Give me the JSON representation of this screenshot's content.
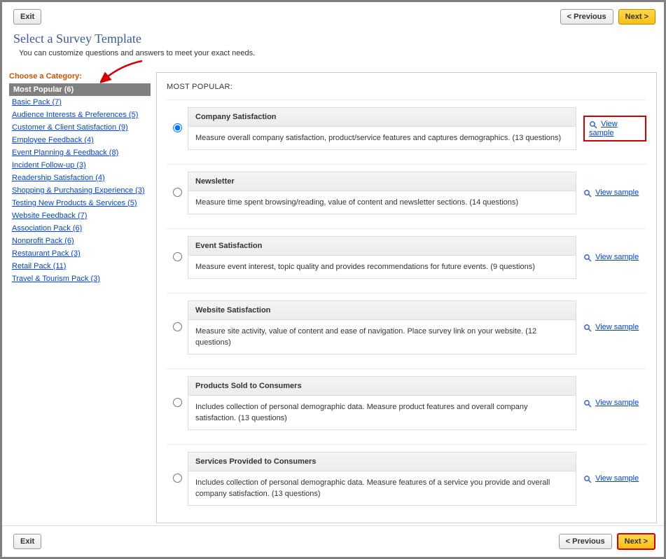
{
  "buttons": {
    "exit": "Exit",
    "previous": "< Previous",
    "next": "Next >"
  },
  "header": {
    "title": "Select a Survey Template",
    "subtitle": "You can customize questions and answers to meet your exact needs."
  },
  "sidebar": {
    "label": "Choose a Category:",
    "active": "Most Popular (6)",
    "items": [
      "Basic Pack (7)",
      "Audience Interests & Preferences (5)",
      "Customer & Client Satisfaction (9)",
      "Employee Feedback (4)",
      "Event Planning & Feedback (8)",
      "Incident Follow-up (3)",
      "Readership Satisfaction (4)",
      "Shopping & Purchasing Experience (3)",
      "Testing New Products & Services (5)",
      "Website Feedback (7)",
      "Association Pack (6)",
      "Nonprofit Pack (6)",
      "Restaurant Pack (3)",
      "Retail Pack (11)",
      "Travel & Tourism Pack (3)"
    ]
  },
  "content": {
    "section_title": "MOST POPULAR:",
    "view_sample": "View sample",
    "templates": [
      {
        "title": "Company Satisfaction",
        "desc": "Measure overall company satisfaction, product/service features and captures demographics. (13 questions)"
      },
      {
        "title": "Newsletter",
        "desc": "Measure time spent browsing/reading, value of content and newsletter sections. (14 questions)"
      },
      {
        "title": "Event Satisfaction",
        "desc": "Measure event interest, topic quality and provides recommendations for future events. (9 questions)"
      },
      {
        "title": "Website Satisfaction",
        "desc": "Measure site activity, value of content and ease of navigation. Place survey link on your website. (12 questions)"
      },
      {
        "title": "Products Sold to Consumers",
        "desc": "Includes collection of personal demographic data. Measure product features and overall company satisfaction. (13 questions)"
      },
      {
        "title": "Services Provided to Consumers",
        "desc": "Includes collection of personal demographic data. Measure features of a service you provide and overall company satisfaction. (13 questions)"
      }
    ]
  }
}
